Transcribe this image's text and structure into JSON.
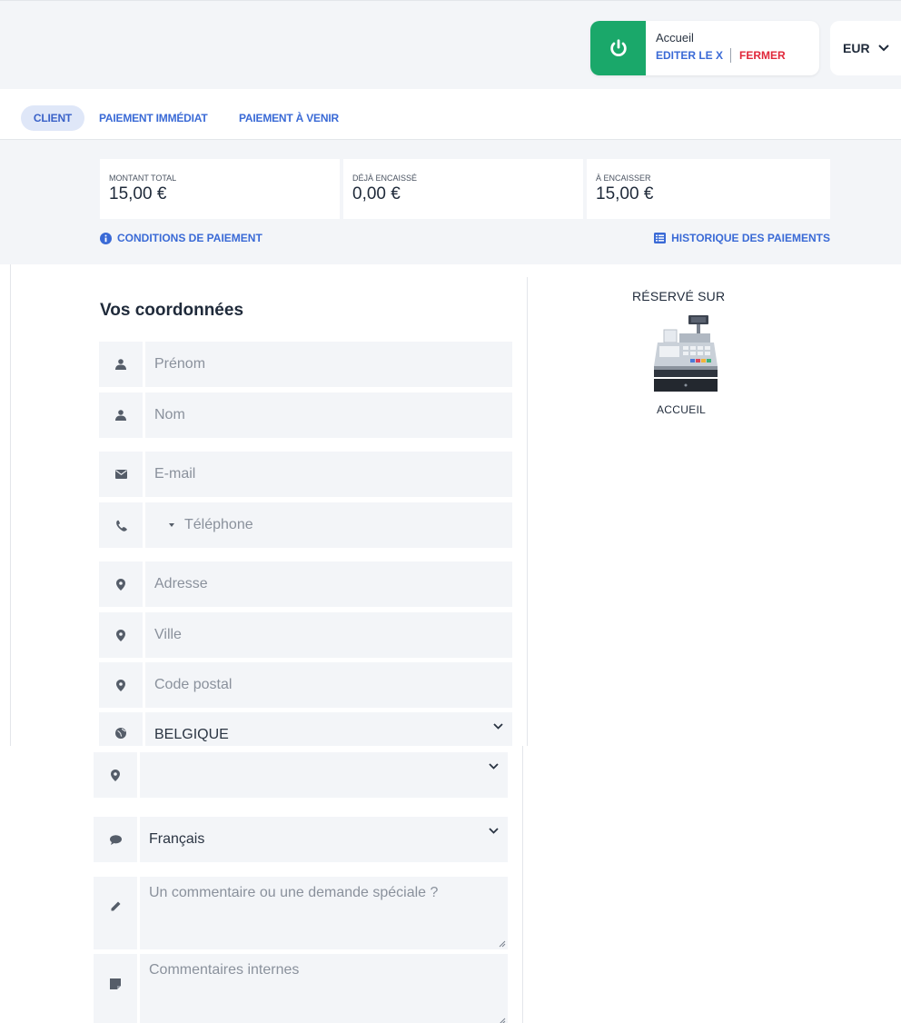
{
  "header": {
    "station_title": "Accueil",
    "edit_label": "EDITER LE X",
    "close_label": "FERMER",
    "currency": "EUR"
  },
  "tabs": [
    {
      "label": "CLIENT",
      "active": true
    },
    {
      "label": "PAIEMENT IMMÉDIAT",
      "active": false
    },
    {
      "label": "PAIEMENT À VENIR",
      "active": false
    }
  ],
  "summary": {
    "total_label": "MONTANT TOTAL",
    "total_value": "15,00 €",
    "paid_label": "DÉJÀ ENCAISSÉ",
    "paid_value": "0,00 €",
    "due_label": "À ENCAISSER",
    "due_value": "15,00 €",
    "conditions_link": "CONDITIONS DE PAIEMENT",
    "history_link": "HISTORIQUE DES PAIEMENTS"
  },
  "form": {
    "title": "Vos coordonnées",
    "first_name_placeholder": "Prénom",
    "last_name_placeholder": "Nom",
    "email_placeholder": "E-mail",
    "phone_placeholder": "Téléphone",
    "address_placeholder": "Adresse",
    "city_placeholder": "Ville",
    "postal_placeholder": "Code postal",
    "country_value": "BELGIQUE",
    "region_value": "",
    "language_value": "Français",
    "comment_placeholder": "Un commentaire ou une demande spéciale ?",
    "internal_comment_placeholder": "Commentaires internes"
  },
  "reserved": {
    "title": "RÉSERVÉ SUR",
    "place": "ACCUEIL"
  },
  "colors": {
    "accent": "#3a6ad6",
    "power_green": "#1aa86a",
    "close_red": "#e0273a",
    "panel_bg": "#f3f5f8"
  }
}
